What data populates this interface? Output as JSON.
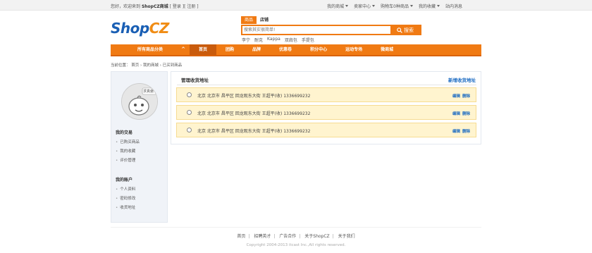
{
  "topbar": {
    "welcome_prefix": "您好，欢迎来到",
    "site_name": "ShopCZ商城",
    "login": "登录",
    "register": "注册",
    "links": [
      {
        "label": "我的商城",
        "has_caret": true
      },
      {
        "label": "卖家中心",
        "has_caret": true
      },
      {
        "label": "购物车0种商品",
        "has_caret": true
      },
      {
        "label": "我的收藏",
        "has_caret": true
      },
      {
        "label": "站内消息",
        "has_caret": false
      }
    ]
  },
  "logo": {
    "part1": "Shop",
    "part2": "CZ"
  },
  "search": {
    "tabs": [
      "商品",
      "店铺"
    ],
    "placeholder": "搜索其实很简单!",
    "button_label": "搜索",
    "hotwords": [
      "李宁",
      "耐克",
      "Kappa",
      "双肩包",
      "手提包"
    ]
  },
  "nav": {
    "all_categories": "所有商品分类",
    "items": [
      "首页",
      "团购",
      "品牌",
      "优惠卷",
      "积分中心",
      "运动专场",
      "微商城"
    ]
  },
  "breadcrumb": "当前位置： 首页 › 我的商城 › 已买到商品",
  "sidebar": {
    "avatar_caption": "求真傲",
    "groups": [
      {
        "title": "我的交易",
        "items": [
          "已购买商品",
          "我的收藏",
          "评价管理"
        ]
      },
      {
        "title": "我的账户",
        "items": [
          "个人资料",
          "密码修改",
          "收货地址"
        ]
      }
    ]
  },
  "panel": {
    "title": "管理收货地址",
    "add_link": "新增收货地址",
    "addresses": [
      {
        "text": "北京   北京市   昌平区   回龙观东大街   王超平(收)   1336699232",
        "edit": "编辑",
        "delete": "删除"
      },
      {
        "text": "北京   北京市   昌平区   回龙观东大街   王超平(收)   1336699232",
        "edit": "编辑",
        "delete": "删除"
      },
      {
        "text": "北京   北京市   昌平区   回龙观东大街   王超平(收)   1336699232",
        "edit": "编辑",
        "delete": "删除"
      }
    ]
  },
  "footer": {
    "links": [
      "首页",
      "招聘英才",
      "广告合作",
      "关于ShopCZ",
      "关于我们"
    ],
    "copyright": "Copyright 2004-2013 itcast Inc.,All rights reserved."
  },
  "colors": {
    "brand_orange": "#f07a13",
    "brand_blue": "#1a5fb4",
    "link_blue": "#1a6ac2",
    "row_bg": "#fff4cf"
  }
}
